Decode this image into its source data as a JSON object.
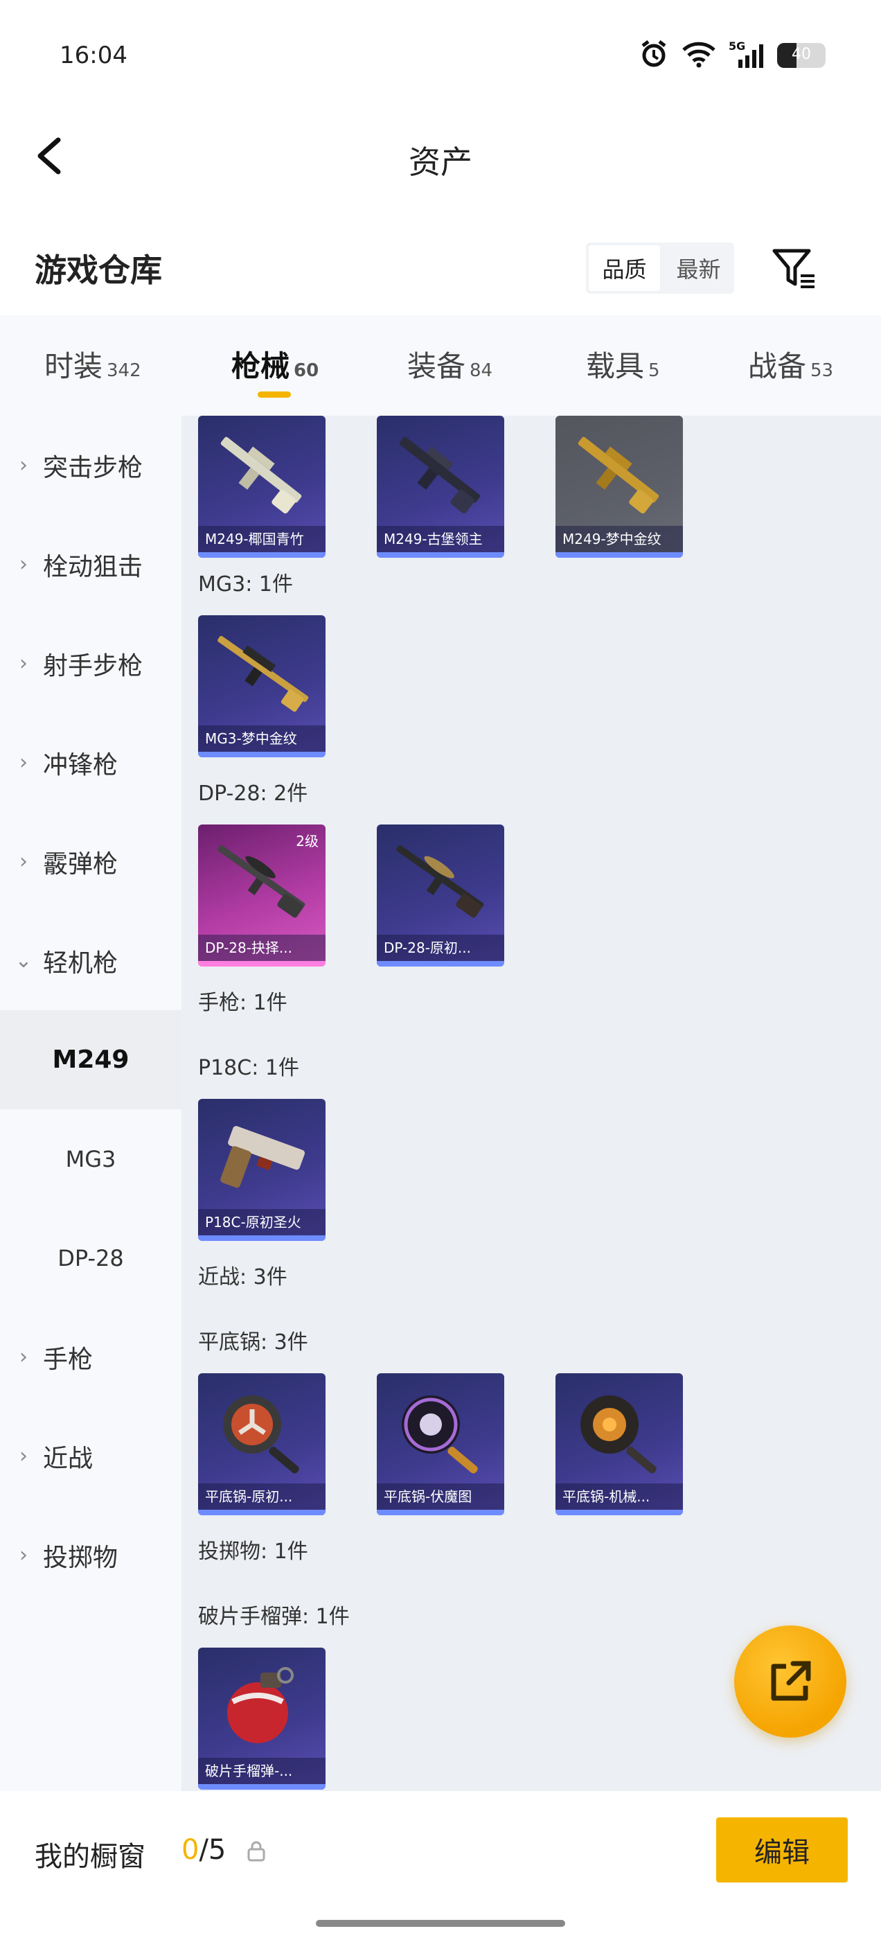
{
  "status_bar": {
    "time": "16:04",
    "network": "5G",
    "battery": "40"
  },
  "nav": {
    "title": "资产"
  },
  "warehouse": {
    "title": "游戏仓库",
    "sort_options": [
      "品质",
      "最新"
    ],
    "active_sort": "品质"
  },
  "tabs": [
    {
      "label": "时装",
      "count": "342"
    },
    {
      "label": "枪械",
      "count": "60"
    },
    {
      "label": "装备",
      "count": "84"
    },
    {
      "label": "载具",
      "count": "5"
    },
    {
      "label": "战备",
      "count": "53"
    }
  ],
  "active_tab": "枪械",
  "sidebar": {
    "items": [
      {
        "label": "突击步枪",
        "chevron": "right"
      },
      {
        "label": "栓动狙击",
        "chevron": "right"
      },
      {
        "label": "射手步枪",
        "chevron": "right"
      },
      {
        "label": "冲锋枪",
        "chevron": "right"
      },
      {
        "label": "霰弹枪",
        "chevron": "right"
      },
      {
        "label": "轻机枪",
        "chevron": "down"
      }
    ],
    "sub_items": [
      {
        "label": "M249",
        "active": true
      },
      {
        "label": "MG3",
        "active": false
      },
      {
        "label": "DP-28",
        "active": false
      }
    ],
    "items_after": [
      {
        "label": "手枪",
        "chevron": "right"
      },
      {
        "label": "近战",
        "chevron": "right"
      },
      {
        "label": "投掷物",
        "chevron": "right"
      }
    ]
  },
  "content": {
    "m249_cards": [
      {
        "caption": "M249-椰国青竹"
      },
      {
        "caption": "M249-古堡领主"
      },
      {
        "caption": "M249-梦中金纹"
      }
    ],
    "mg3_label": "MG3: 1件",
    "mg3_cards": [
      {
        "caption": "MG3-梦中金纹"
      }
    ],
    "dp28_label": "DP-28: 2件",
    "dp28_cards": [
      {
        "caption": "DP-28-抉择...",
        "badge": "2级"
      },
      {
        "caption": "DP-28-原初..."
      }
    ],
    "pistol_label": "手枪: 1件",
    "p18c_label": "P18C: 1件",
    "p18c_cards": [
      {
        "caption": "P18C-原初圣火"
      }
    ],
    "melee_label": "近战: 3件",
    "pan_label": "平底锅: 3件",
    "pan_cards": [
      {
        "caption": "平底锅-原初..."
      },
      {
        "caption": "平底锅-伏魔图"
      },
      {
        "caption": "平底锅-机械..."
      }
    ],
    "throwable_label": "投掷物: 1件",
    "frag_label": "破片手榴弹: 1件",
    "frag_cards": [
      {
        "caption": "破片手榴弹-..."
      }
    ]
  },
  "showcase": {
    "label": "我的橱窗",
    "current": "0",
    "total": "/5",
    "edit_label": "编辑"
  },
  "colors": {
    "accent": "#f5b400",
    "card_purple": "#3d3a8c",
    "card_gray": "#5d6069",
    "card_pink": "#b23ca4"
  }
}
